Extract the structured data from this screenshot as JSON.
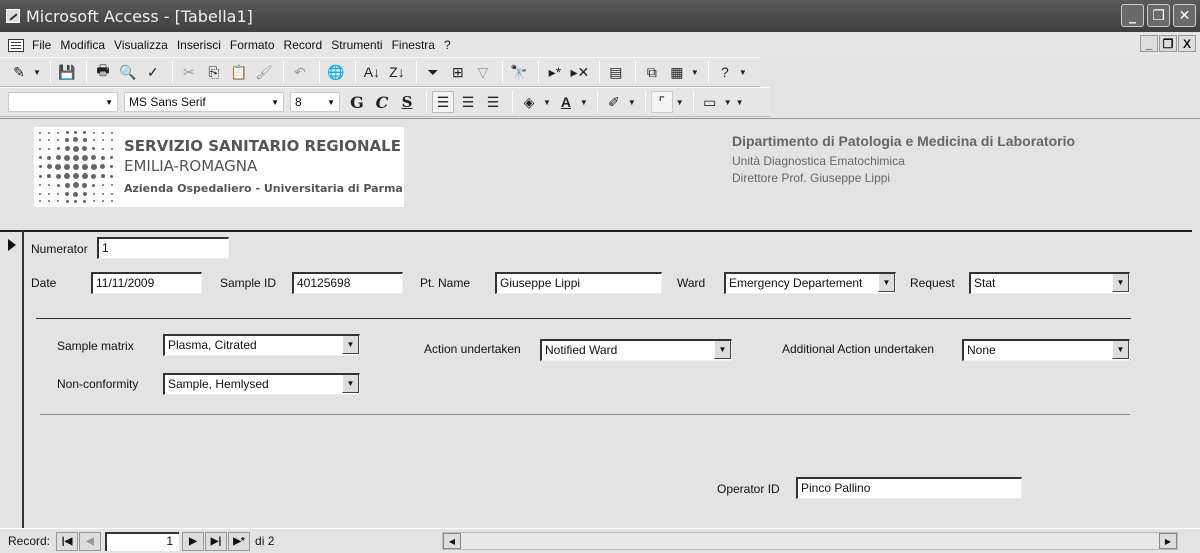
{
  "window": {
    "title": "Microsoft Access - [Tabella1]",
    "controls": {
      "minimize": "_",
      "restore": "❐",
      "close": "✕"
    }
  },
  "menubar": {
    "items": [
      "File",
      "Modifica",
      "Visualizza",
      "Inserisci",
      "Formato",
      "Record",
      "Strumenti",
      "Finestra",
      "?"
    ],
    "mdi_controls": {
      "minimize": "_",
      "restore": "❐",
      "close": "X"
    }
  },
  "toolbar_format": {
    "object_combo": "",
    "font_name": "MS Sans Serif",
    "font_size": "8",
    "bold": "G",
    "italic": "C",
    "underline": "S"
  },
  "header": {
    "logo": {
      "line1": "SERVIZIO SANITARIO REGIONALE",
      "line2": "EMILIA-ROMAGNA",
      "line3": "Azienda Ospedaliero - Universitaria di Parma"
    },
    "department": {
      "name": "Dipartimento di Patologia e Medicina di Laboratorio",
      "unit": "Unità Diagnostica Ematochimica",
      "director": "Direttore Prof. Giuseppe Lippi"
    }
  },
  "form": {
    "numerator": {
      "label": "Numerator",
      "value": "1"
    },
    "date": {
      "label": "Date",
      "value": "11/11/2009"
    },
    "sample_id": {
      "label": "Sample ID",
      "value": "40125698"
    },
    "pt_name": {
      "label": "Pt. Name",
      "value": "Giuseppe Lippi"
    },
    "ward": {
      "label": "Ward",
      "value": "Emergency Departement"
    },
    "request": {
      "label": "Request",
      "value": "Stat"
    },
    "sample_matrix": {
      "label": "Sample matrix",
      "value": "Plasma, Citrated"
    },
    "non_conformity": {
      "label": "Non-conformity",
      "value": "Sample, Hemlysed"
    },
    "action_undertaken": {
      "label": "Action undertaken",
      "value": "Notified Ward"
    },
    "additional_action": {
      "label": "Additional Action undertaken",
      "value": "None"
    },
    "operator_id": {
      "label": "Operator ID",
      "value": "Pinco Pallino"
    }
  },
  "record_nav": {
    "label": "Record:",
    "current": "1",
    "total_text": "di 2"
  }
}
